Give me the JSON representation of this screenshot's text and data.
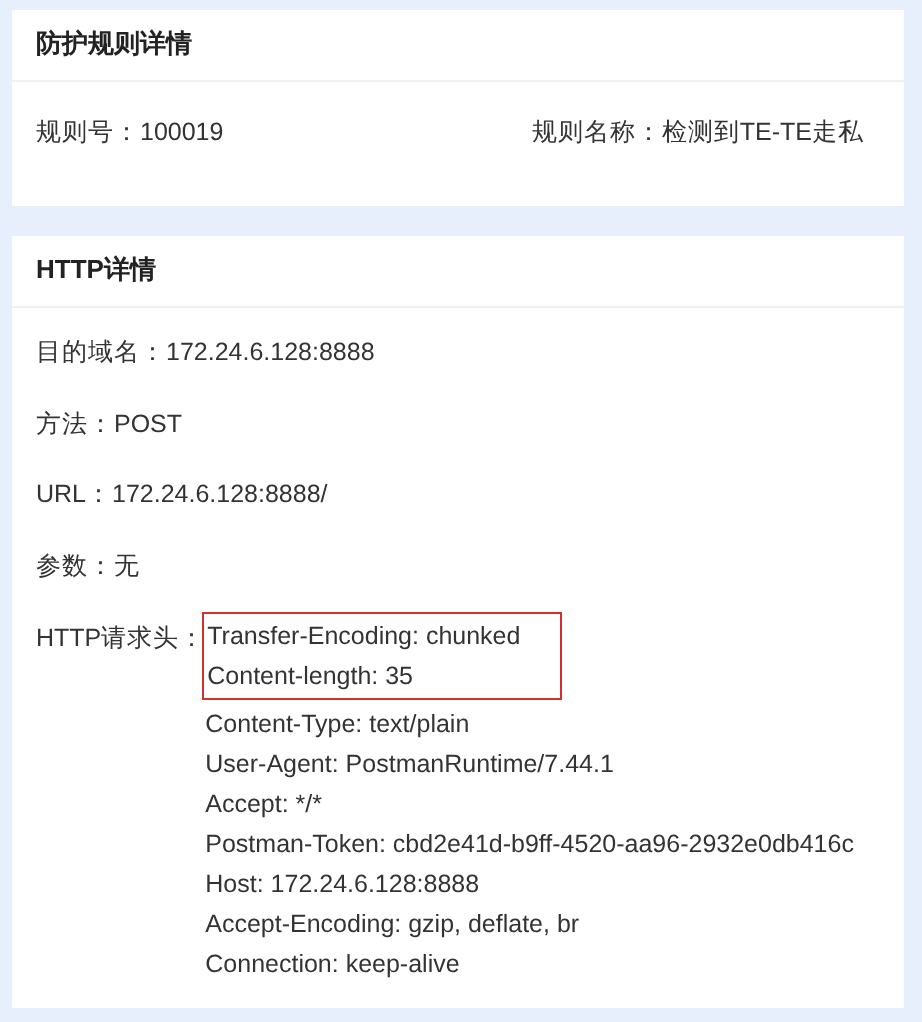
{
  "rule_section": {
    "title": "防护规则详情",
    "fields": [
      {
        "label": "规则号：",
        "value": "100019"
      },
      {
        "label": "规则名称：",
        "value": "检测到TE-TE走私"
      }
    ]
  },
  "http_section": {
    "title": "HTTP详情",
    "fields": [
      {
        "label": "目的域名：",
        "value": "172.24.6.128:8888"
      },
      {
        "label": "方法：",
        "value": "POST"
      },
      {
        "label": "URL：",
        "value": "172.24.6.128:8888/"
      },
      {
        "label": "参数：",
        "value": "无"
      }
    ],
    "headers_label": "HTTP请求头：",
    "headers": [
      {
        "text": "Transfer-Encoding: chunked",
        "highlighted": true
      },
      {
        "text": "Content-length: 35",
        "highlighted": true
      },
      {
        "text": "Content-Type: text/plain",
        "highlighted": false
      },
      {
        "text": "User-Agent: PostmanRuntime/7.44.1",
        "highlighted": false
      },
      {
        "text": "Accept: */*",
        "highlighted": false
      },
      {
        "text": "Postman-Token: cbd2e41d-b9ff-4520-aa96-2932e0db416c",
        "highlighted": false
      },
      {
        "text": "Host: 172.24.6.128:8888",
        "highlighted": false
      },
      {
        "text": "Accept-Encoding: gzip, deflate, br",
        "highlighted": false
      },
      {
        "text": "Connection: keep-alive",
        "highlighted": false
      }
    ]
  }
}
